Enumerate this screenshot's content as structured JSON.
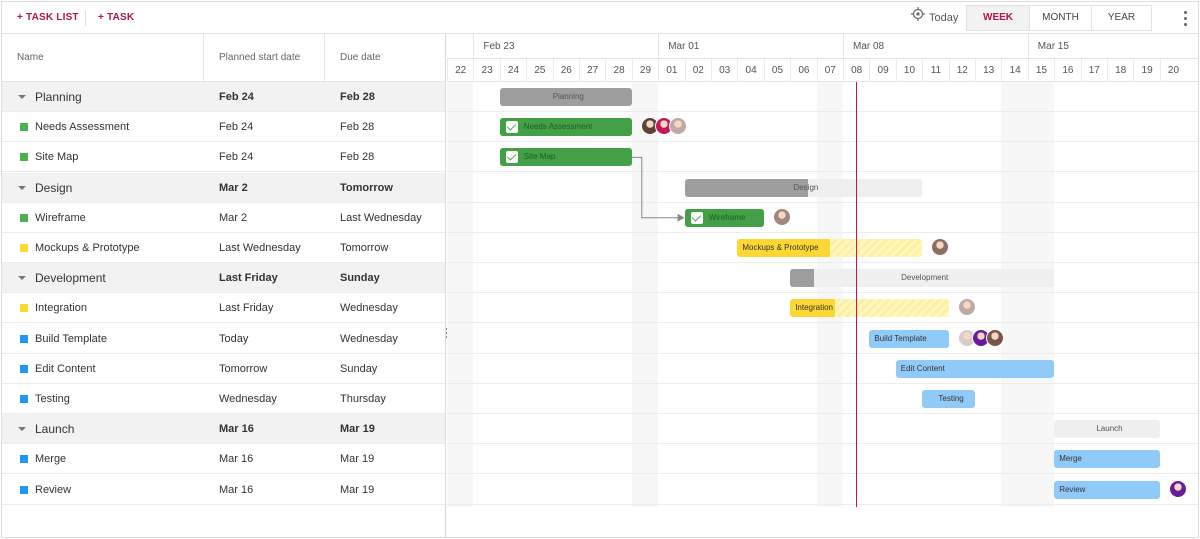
{
  "toolbar": {
    "task_list_label": "+ TASK LIST",
    "task_label": "+ TASK",
    "today_label": "Today",
    "scales": [
      {
        "label": "WEEK",
        "active": true
      },
      {
        "label": "MONTH",
        "active": false
      },
      {
        "label": "YEAR",
        "active": false
      }
    ],
    "accent_color": "#b0154b"
  },
  "grid": {
    "columns": [
      "Name",
      "Planned start date",
      "Due date"
    ],
    "rows": [
      {
        "type": "group",
        "name": "Planning",
        "start": "Feb 24",
        "due": "Feb 28"
      },
      {
        "type": "task",
        "name": "Needs Assessment",
        "start": "Feb 24",
        "due": "Feb 28",
        "color": "#4caf50"
      },
      {
        "type": "task",
        "name": "Site Map",
        "start": "Feb 24",
        "due": "Feb 28",
        "color": "#4caf50"
      },
      {
        "type": "group",
        "name": "Design",
        "start": "Mar 2",
        "due": "Tomorrow"
      },
      {
        "type": "task",
        "name": "Wireframe",
        "start": "Mar 2",
        "due": "Last Wednesday",
        "color": "#4caf50"
      },
      {
        "type": "task",
        "name": "Mockups & Prototype",
        "start": "Last Wednesday",
        "due": "Tomorrow",
        "color": "#fdd835"
      },
      {
        "type": "group",
        "name": "Development",
        "start": "Last Friday",
        "due": "Sunday"
      },
      {
        "type": "task",
        "name": "Integration",
        "start": "Last Friday",
        "due": "Wednesday",
        "color": "#fdd835"
      },
      {
        "type": "task",
        "name": "Build Template",
        "start": "Today",
        "due": "Wednesday",
        "color": "#2196f3"
      },
      {
        "type": "task",
        "name": "Edit Content",
        "start": "Tomorrow",
        "due": "Sunday",
        "color": "#2196f3"
      },
      {
        "type": "task",
        "name": "Testing",
        "start": "Wednesday",
        "due": "Thursday",
        "color": "#2196f3"
      },
      {
        "type": "group",
        "name": "Launch",
        "start": "Mar 16",
        "due": "Mar 19"
      },
      {
        "type": "task",
        "name": "Merge",
        "start": "Mar 16",
        "due": "Mar 19",
        "color": "#2196f3"
      },
      {
        "type": "task",
        "name": "Review",
        "start": "Mar 16",
        "due": "Mar 19",
        "color": "#2196f3"
      }
    ]
  },
  "timeline": {
    "first_day": 22,
    "months": [
      {
        "label": "Feb 23",
        "start_index": 1
      },
      {
        "label": "Mar 01",
        "start_index": 8
      },
      {
        "label": "Mar 08",
        "start_index": 15
      },
      {
        "label": "Mar 15",
        "start_index": 22
      }
    ],
    "days": [
      "22",
      "23",
      "24",
      "25",
      "26",
      "27",
      "28",
      "29",
      "01",
      "02",
      "03",
      "04",
      "05",
      "06",
      "07",
      "08",
      "09",
      "10",
      "11",
      "12",
      "13",
      "14",
      "15",
      "16",
      "17",
      "18",
      "19",
      "20"
    ],
    "weekend_indices": [
      0,
      7,
      14,
      21,
      22
    ],
    "today_index": 15.5,
    "bars": [
      {
        "row": 0,
        "label": "Planning",
        "start": 2,
        "end": 7,
        "kind": "group",
        "progress": 1,
        "color": "#9e9e9e",
        "label_pos": "center"
      },
      {
        "row": 1,
        "label": "Needs Assessment",
        "start": 2,
        "end": 7,
        "kind": "done",
        "progress": 1,
        "color": "#4caf50",
        "avatars": [
          "#5d4037",
          "#c2185b",
          "#bcaaa4"
        ]
      },
      {
        "row": 2,
        "label": "Site Map",
        "start": 2,
        "end": 7,
        "kind": "done",
        "progress": 1,
        "color": "#4caf50"
      },
      {
        "row": 3,
        "label": "Design",
        "start": 9,
        "end": 18,
        "kind": "group",
        "progress": 0.52,
        "color": "#9e9e9e",
        "label_pos": "center"
      },
      {
        "row": 4,
        "label": "Wireframe",
        "start": 9,
        "end": 12,
        "kind": "done",
        "progress": 1,
        "color": "#4caf50",
        "avatars": [
          "#a1887f"
        ]
      },
      {
        "row": 5,
        "label": "Mockups & Prototype",
        "start": 11,
        "end": 18,
        "kind": "task",
        "progress": 0.5,
        "color": "#fdd835",
        "avatars": [
          "#8d6e63"
        ]
      },
      {
        "row": 6,
        "label": "Development",
        "start": 13,
        "end": 23,
        "kind": "group",
        "progress": 0.09,
        "color": "#9e9e9e",
        "label_pos": "center"
      },
      {
        "row": 7,
        "label": "Integration",
        "start": 13,
        "end": 19,
        "kind": "task",
        "progress": 0.28,
        "color": "#fdd835",
        "avatars": [
          "#bcaaa4"
        ]
      },
      {
        "row": 8,
        "label": "Build Template",
        "start": 16,
        "end": 19,
        "kind": "task",
        "progress": 0,
        "color": "#90caf9",
        "avatars": [
          "#d7ccc8",
          "#6a1b9a",
          "#795548"
        ]
      },
      {
        "row": 9,
        "label": "Edit Content",
        "start": 17,
        "end": 23,
        "kind": "task",
        "progress": 0,
        "color": "#90caf9"
      },
      {
        "row": 10,
        "label": "Testing",
        "start": 18,
        "end": 20,
        "kind": "task",
        "progress": 0,
        "color": "#90caf9",
        "label_pos": "center"
      },
      {
        "row": 11,
        "label": "Launch",
        "start": 23,
        "end": 27,
        "kind": "group",
        "progress": 0,
        "color": "#9e9e9e",
        "label_pos": "center"
      },
      {
        "row": 12,
        "label": "Merge",
        "start": 23,
        "end": 27,
        "kind": "task",
        "progress": 0,
        "color": "#90caf9"
      },
      {
        "row": 13,
        "label": "Review",
        "start": 23,
        "end": 27,
        "kind": "task",
        "progress": 0,
        "color": "#90caf9",
        "avatars": [
          "#6a1b9a"
        ]
      }
    ],
    "dependencies": [
      {
        "from_row": 2,
        "to_row": 4
      }
    ]
  }
}
